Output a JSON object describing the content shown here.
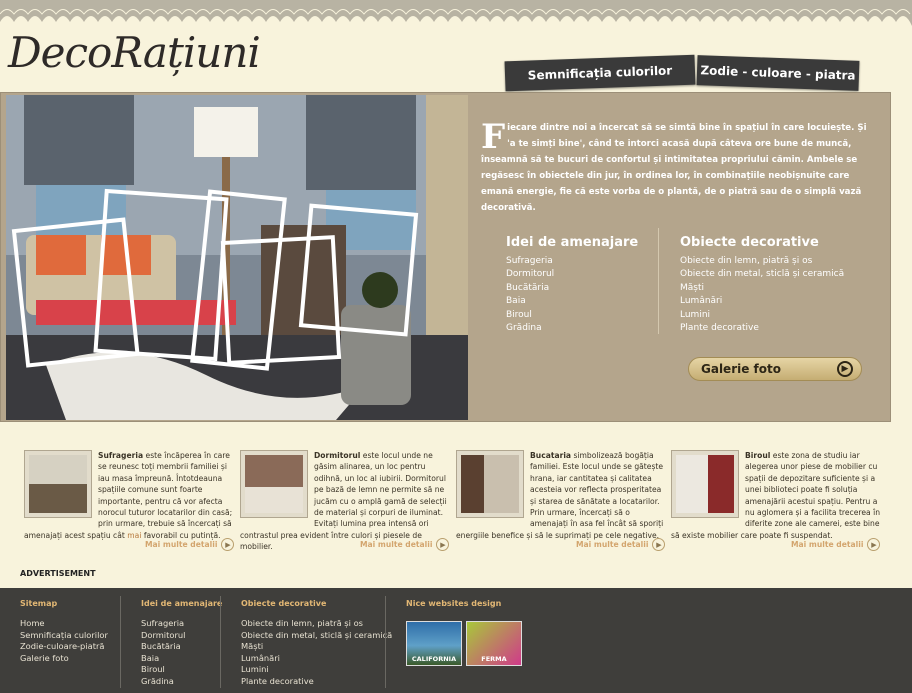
{
  "site": {
    "logo": "DecoRațiuni"
  },
  "nav": {
    "tabs": [
      {
        "label": "Semnificația culorilor"
      },
      {
        "label": "Zodie - culoare - piatra"
      }
    ]
  },
  "hero": {
    "intro_dropcap": "F",
    "intro_text": "iecare dintre noi a încercat să se simtă bine în spațiul în care locuiește. Și 'a te simți bine', când te intorci acasă după câteva ore bune de muncă, înseamnă să te bucuri de confortul și intimitatea propriului cămin. Ambele se regăsesc în obiectele din jur, în ordinea lor, în combinațiile neobișnuite care emană energie, fie că este vorba de o plantă, de o piatră sau de o simplă vază decorativă.",
    "col1": {
      "title": "Idei de amenajare",
      "items": [
        "Sufrageria",
        "Dormitorul",
        "Bucătăria",
        "Baia",
        "Biroul",
        "Grădina"
      ]
    },
    "col2": {
      "title": "Obiecte decorative",
      "items": [
        "Obiecte din lemn, piatră și os",
        "Obiecte din metal, sticlă și ceramică",
        "Măști",
        "Lumânări",
        "Lumini",
        "Plante decorative"
      ]
    },
    "gallery_button": "Galerie foto"
  },
  "rooms": [
    {
      "name": "Sufrageria",
      "text": " este încăperea în care se reunesc toți membrii familiei și iau masa împreună. Întotdeauna spațiile comune sunt foarte importante, pentru că vor afecta norocul tuturor locatarilor din casă; prin urmare, trebuie să încercați să amenajați acest spațiu cât ",
      "link": "mai",
      "text_end": " favorabil cu putință.",
      "more": "Mai multe detalii"
    },
    {
      "name": "Dormitorul",
      "text": " este locul unde ne găsim alinarea, un loc pentru odihnă, un loc al iubirii. Dormitorul pe bază de lemn ne permite să ne jucăm cu o amplă gamă de selecții de material și corpuri de iluminat. Evitați lumina prea intensă ori contrastul prea evident între culori și piesele de mobilier.",
      "more": "Mai multe detalii"
    },
    {
      "name": "Bucataria",
      "text": " simbolizează bogăția familiei. Este locul unde se gătește hrana, iar cantitatea și calitatea acesteia vor reflecta prosperitatea și starea de sănătate a locatarilor. Prin urmare, încercați să o amenajați în asa fel încât să sporiți energiile benefice și să le suprimați pe cele negative.",
      "more": "Mai multe detalii"
    },
    {
      "name": "Biroul",
      "text": " este zona de studiu iar alegerea unor piese de mobilier cu spații de depozitare suficiente și a unei biblioteci poate fi soluția amenajării acestui spațiu. Pentru a nu aglomera și a facilita trecerea în diferite zone ale camerei, este bine să existe mobilier care poate fi suspendat.",
      "more": "Mai multe detalii"
    }
  ],
  "advert": "ADVERTISEMENT",
  "footer": {
    "sitemap": {
      "title": "Sitemap",
      "items": [
        "Home",
        "Semnificația culorilor",
        "Zodie-culoare-piatră",
        "Galerie foto"
      ]
    },
    "ideas": {
      "title": "Idei de amenajare",
      "items": [
        "Sufrageria",
        "Dormitorul",
        "Bucătăria",
        "Baia",
        "Biroul",
        "Grădina"
      ]
    },
    "objects": {
      "title": "Obiecte decorative",
      "items": [
        "Obiecte din lemn, piatră și os",
        "Obiecte din metal, sticlă și ceramică",
        "Măști",
        "Lumânări",
        "Lumini",
        "Plante decorative"
      ]
    },
    "nice": {
      "title": "Nice websites design",
      "badges": [
        "CALIFORNIA",
        "FERMA"
      ]
    }
  },
  "colors": {
    "hero_bg": "#b4a58c",
    "page_bg": "#f8f3dc",
    "footer_bg": "#3f3e3b",
    "footer_heading": "#e2b774",
    "tab_bg": "#3a3a3a"
  }
}
